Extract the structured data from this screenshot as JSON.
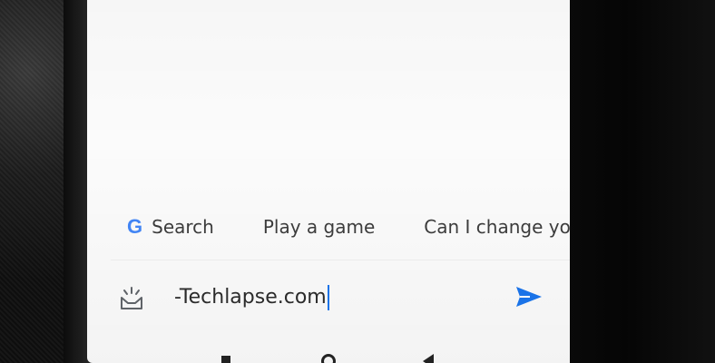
{
  "suggestions": [
    {
      "label": "Search",
      "icon": "google-g-icon"
    },
    {
      "label": "Play a game"
    },
    {
      "label": "Can I change you"
    }
  ],
  "input": {
    "value": "-Techlapse.com",
    "icon": "assistant-icon"
  },
  "send": {
    "icon": "send-icon",
    "color": "#1a73e8"
  },
  "colors": {
    "google_blue": "#4285F4",
    "google_red": "#EA4335",
    "google_yellow": "#FBBC05",
    "google_green": "#34A853"
  }
}
